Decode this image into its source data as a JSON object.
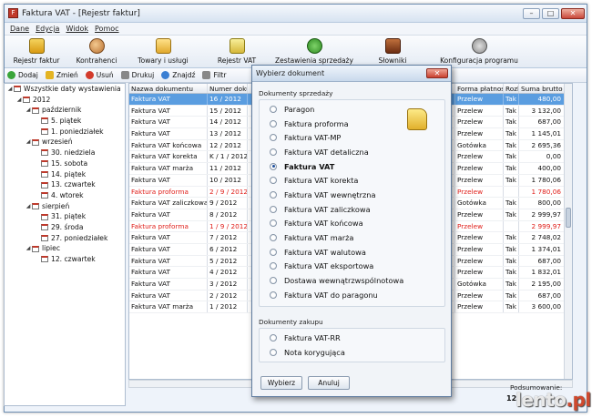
{
  "window": {
    "title": "Faktura VAT - [Rejestr faktur]"
  },
  "menu": [
    "Dane",
    "Edycja",
    "Widok",
    "Pomoc"
  ],
  "toolbar": [
    {
      "label": "Rejestr faktur",
      "icon": "register-icon"
    },
    {
      "label": "Kontrahenci",
      "icon": "contacts-icon"
    },
    {
      "label": "Towary i usługi",
      "icon": "folder-icon"
    },
    {
      "label": "Rejestr VAT",
      "icon": "document-icon"
    },
    {
      "label": "Zestawienia sprzedaży",
      "icon": "pie-chart-icon"
    },
    {
      "label": "Słowniki",
      "icon": "book-icon"
    },
    {
      "label": "Konfiguracja programu",
      "icon": "settings-icon"
    }
  ],
  "actions": [
    {
      "label": "Dodaj",
      "icon": "add-icon"
    },
    {
      "label": "Zmień",
      "icon": "edit-icon"
    },
    {
      "label": "Usuń",
      "icon": "delete-icon"
    },
    {
      "label": "Drukuj",
      "icon": "print-icon"
    },
    {
      "label": "Znajdź",
      "icon": "find-icon"
    },
    {
      "label": "Filtr",
      "icon": "filter-icon"
    }
  ],
  "tree": [
    {
      "label": "Wszystkie daty wystawienia",
      "level": 0,
      "expander": "◢"
    },
    {
      "label": "2012",
      "level": 1,
      "expander": "◢"
    },
    {
      "label": "październik",
      "level": 2,
      "expander": "◢"
    },
    {
      "label": "5. piątek",
      "level": 3,
      "expander": ""
    },
    {
      "label": "1. poniedziałek",
      "level": 3,
      "expander": ""
    },
    {
      "label": "wrzesień",
      "level": 2,
      "expander": "◢"
    },
    {
      "label": "30. niedziela",
      "level": 3,
      "expander": ""
    },
    {
      "label": "15. sobota",
      "level": 3,
      "expander": ""
    },
    {
      "label": "14. piątek",
      "level": 3,
      "expander": ""
    },
    {
      "label": "13. czwartek",
      "level": 3,
      "expander": ""
    },
    {
      "label": "4. wtorek",
      "level": 3,
      "expander": ""
    },
    {
      "label": "sierpień",
      "level": 2,
      "expander": "◢"
    },
    {
      "label": "31. piątek",
      "level": 3,
      "expander": ""
    },
    {
      "label": "29. środa",
      "level": 3,
      "expander": ""
    },
    {
      "label": "27. poniedziałek",
      "level": 3,
      "expander": ""
    },
    {
      "label": "lipiec",
      "level": 2,
      "expander": "◢"
    },
    {
      "label": "12. czwartek",
      "level": 3,
      "expander": ""
    }
  ],
  "grid": {
    "left_headers": [
      "Nazwa dokumentu",
      "Numer dokum"
    ],
    "right_headers": [
      "Forma płatności",
      "Rozlic",
      "Suma brutto [zł]"
    ],
    "rows": [
      {
        "name": "Faktura VAT",
        "num": "16 / 2012",
        "pay": "Przelew",
        "rozl": "Tak",
        "sum": "480,00",
        "style": "sel"
      },
      {
        "name": "Faktura VAT",
        "num": "15 / 2012",
        "pay": "Przelew",
        "rozl": "Tak",
        "sum": "3 132,00",
        "style": ""
      },
      {
        "name": "Faktura VAT",
        "num": "14 / 2012",
        "pay": "Przelew",
        "rozl": "Tak",
        "sum": "687,00",
        "style": ""
      },
      {
        "name": "Faktura VAT",
        "num": "13 / 2012",
        "pay": "Przelew",
        "rozl": "Tak",
        "sum": "1 145,01",
        "style": ""
      },
      {
        "name": "Faktura VAT końcowa",
        "num": "12 / 2012",
        "pay": "Gotówka",
        "rozl": "Tak",
        "sum": "2 695,36",
        "style": ""
      },
      {
        "name": "Faktura VAT korekta",
        "num": "K / 1 / 2012",
        "pay": "Przelew",
        "rozl": "Tak",
        "sum": "0,00",
        "style": ""
      },
      {
        "name": "Faktura VAT marża",
        "num": "11 / 2012",
        "pay": "Przelew",
        "rozl": "Tak",
        "sum": "400,00",
        "style": ""
      },
      {
        "name": "Faktura VAT",
        "num": "10 / 2012",
        "pay": "Przelew",
        "rozl": "Tak",
        "sum": "1 780,06",
        "style": ""
      },
      {
        "name": "Faktura proforma",
        "num": "2 / 9 / 2012",
        "pay": "Przelew",
        "rozl": "",
        "sum": "1 780,06",
        "style": "red"
      },
      {
        "name": "Faktura VAT zaliczkowa",
        "num": "9 / 2012",
        "pay": "Gotówka",
        "rozl": "Tak",
        "sum": "800,00",
        "style": ""
      },
      {
        "name": "Faktura VAT",
        "num": "8 / 2012",
        "pay": "Przelew",
        "rozl": "Tak",
        "sum": "2 999,97",
        "style": ""
      },
      {
        "name": "Faktura proforma",
        "num": "1 / 9 / 2012",
        "pay": "Przelew",
        "rozl": "",
        "sum": "2 999,97",
        "style": "red"
      },
      {
        "name": "Faktura VAT",
        "num": "7 / 2012",
        "pay": "Przelew",
        "rozl": "Tak",
        "sum": "2 748,02",
        "style": ""
      },
      {
        "name": "Faktura VAT",
        "num": "6 / 2012",
        "pay": "Przelew",
        "rozl": "Tak",
        "sum": "1 374,01",
        "style": ""
      },
      {
        "name": "Faktura VAT",
        "num": "5 / 2012",
        "pay": "Przelew",
        "rozl": "Tak",
        "sum": "687,00",
        "style": ""
      },
      {
        "name": "Faktura VAT",
        "num": "4 / 2012",
        "pay": "Przelew",
        "rozl": "Tak",
        "sum": "1 832,01",
        "style": ""
      },
      {
        "name": "Faktura VAT",
        "num": "3 / 2012",
        "pay": "Gotówka",
        "rozl": "Tak",
        "sum": "2 195,00",
        "style": ""
      },
      {
        "name": "Faktura VAT",
        "num": "2 / 2012",
        "pay": "Przelew",
        "rozl": "Tak",
        "sum": "687,00",
        "style": ""
      },
      {
        "name": "Faktura VAT marża",
        "num": "1 / 2012",
        "pay": "Przelew",
        "rozl": "Tak",
        "sum": "3 600,00",
        "style": ""
      }
    ]
  },
  "summary": {
    "label": "Podsumowanie:",
    "value": "12"
  },
  "watermark": {
    "text": "lento",
    "suffix": ".pl"
  },
  "dialog": {
    "title": "Wybierz dokument",
    "sales_label": "Dokumenty sprzedaży",
    "sales_options": [
      "Paragon",
      "Faktura proforma",
      "Faktura VAT-MP",
      "Faktura VAT detaliczna",
      "Faktura VAT",
      "Faktura VAT korekta",
      "Faktura VAT wewnętrzna",
      "Faktura VAT zaliczkowa",
      "Faktura VAT końcowa",
      "Faktura VAT marża",
      "Faktura VAT walutowa",
      "Faktura VAT eksportowa",
      "Dostawa wewnątrzwspólnotowa",
      "Faktura VAT do paragonu"
    ],
    "selected": "Faktura VAT",
    "purchase_label": "Dokumenty zakupu",
    "purchase_options": [
      "Faktura VAT-RR",
      "Nota korygująca"
    ],
    "ok_label": "Wybierz",
    "cancel_label": "Anuluj"
  },
  "colors": {
    "selection": "#5a9de0",
    "proforma": "#e0201b",
    "titlebar": "#c9d9ec"
  }
}
